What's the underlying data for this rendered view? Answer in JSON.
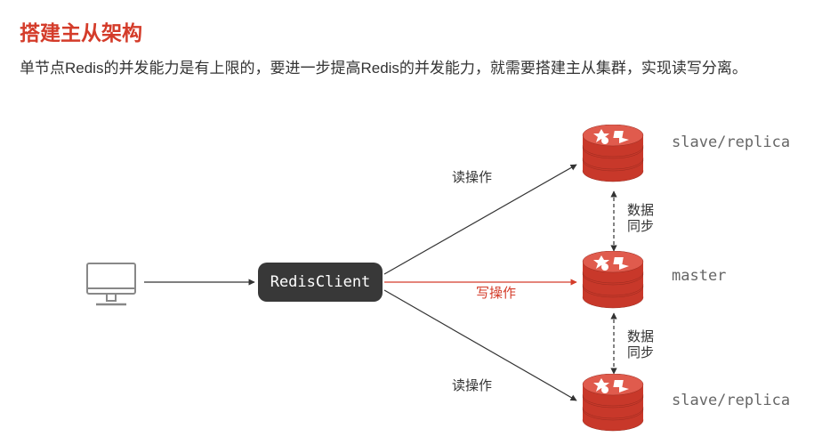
{
  "title": "搭建主从架构",
  "description": "单节点Redis的并发能力是有上限的，要进一步提高Redis的并发能力，就需要搭建主从集群，实现读写分离。",
  "client": {
    "label": "RedisClient"
  },
  "nodes": {
    "slave1": {
      "label": "slave/replica"
    },
    "master": {
      "label": "master"
    },
    "slave2": {
      "label": "slave/replica"
    }
  },
  "edges": {
    "toSlave1": "读操作",
    "toMaster": "写操作",
    "toSlave2": "读操作",
    "sync1": "数据\n同步",
    "sync2": "数据\n同步"
  },
  "colors": {
    "accent": "#d43c2a",
    "node_fill": "#c8382a",
    "node_light": "#e05b4d",
    "client_bg": "#383838",
    "text": "#333",
    "muted": "#666"
  }
}
